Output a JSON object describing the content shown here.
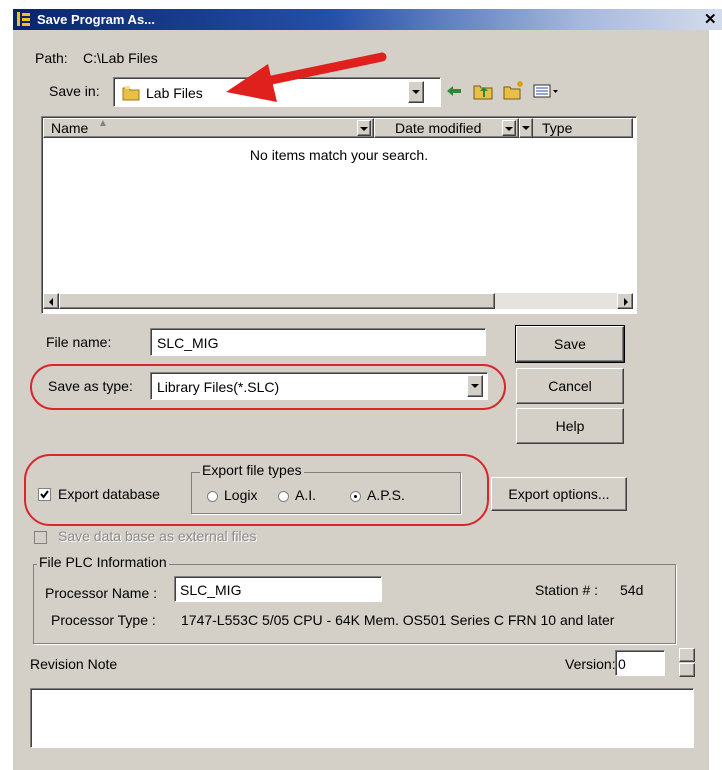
{
  "dialog": {
    "title": "Save Program As...",
    "close_glyph": "✕",
    "path_label": "Path:",
    "path_value": "C:\\Lab Files"
  },
  "save_in": {
    "label": "Save in:",
    "value": "Lab Files",
    "folder_icon": "folder-icon"
  },
  "toolbar": {
    "icons": [
      "back-arrow-icon",
      "up-folder-icon",
      "new-folder-icon",
      "view-menu-icon"
    ]
  },
  "file_list": {
    "columns": [
      "Name",
      "Date modified",
      "Type"
    ],
    "empty_message": "No items match your search."
  },
  "file_name": {
    "label": "File name:",
    "value": "SLC_MIG"
  },
  "save_as_type": {
    "label": "Save as type:",
    "value": "Library Files(*.SLC)"
  },
  "buttons": {
    "save": "Save",
    "cancel": "Cancel",
    "help": "Help",
    "export_options": "Export options..."
  },
  "export": {
    "database_label": "Export database",
    "database_checked": true,
    "file_types_title": "Export file types",
    "options": [
      "Logix",
      "A.I.",
      "A.P.S."
    ],
    "selected": "A.P.S."
  },
  "external_files": {
    "label": "Save data base as external files",
    "enabled": false
  },
  "plc_info": {
    "group_title": "File PLC Information",
    "processor_name_label": "Processor Name :",
    "processor_name_value": "SLC_MIG",
    "station_label": "Station # :",
    "station_value": "54d",
    "processor_type_label": "Processor Type :",
    "processor_type_value": "1747-L553C  5/05 CPU - 64K Mem. OS501 Series C FRN 10 and later"
  },
  "revision": {
    "label": "Revision Note",
    "version_label": "Version:",
    "version_value": "0",
    "note_value": ""
  },
  "annotation": {
    "arrow_color": "#e0201c",
    "oval_color": "#d9262a"
  }
}
